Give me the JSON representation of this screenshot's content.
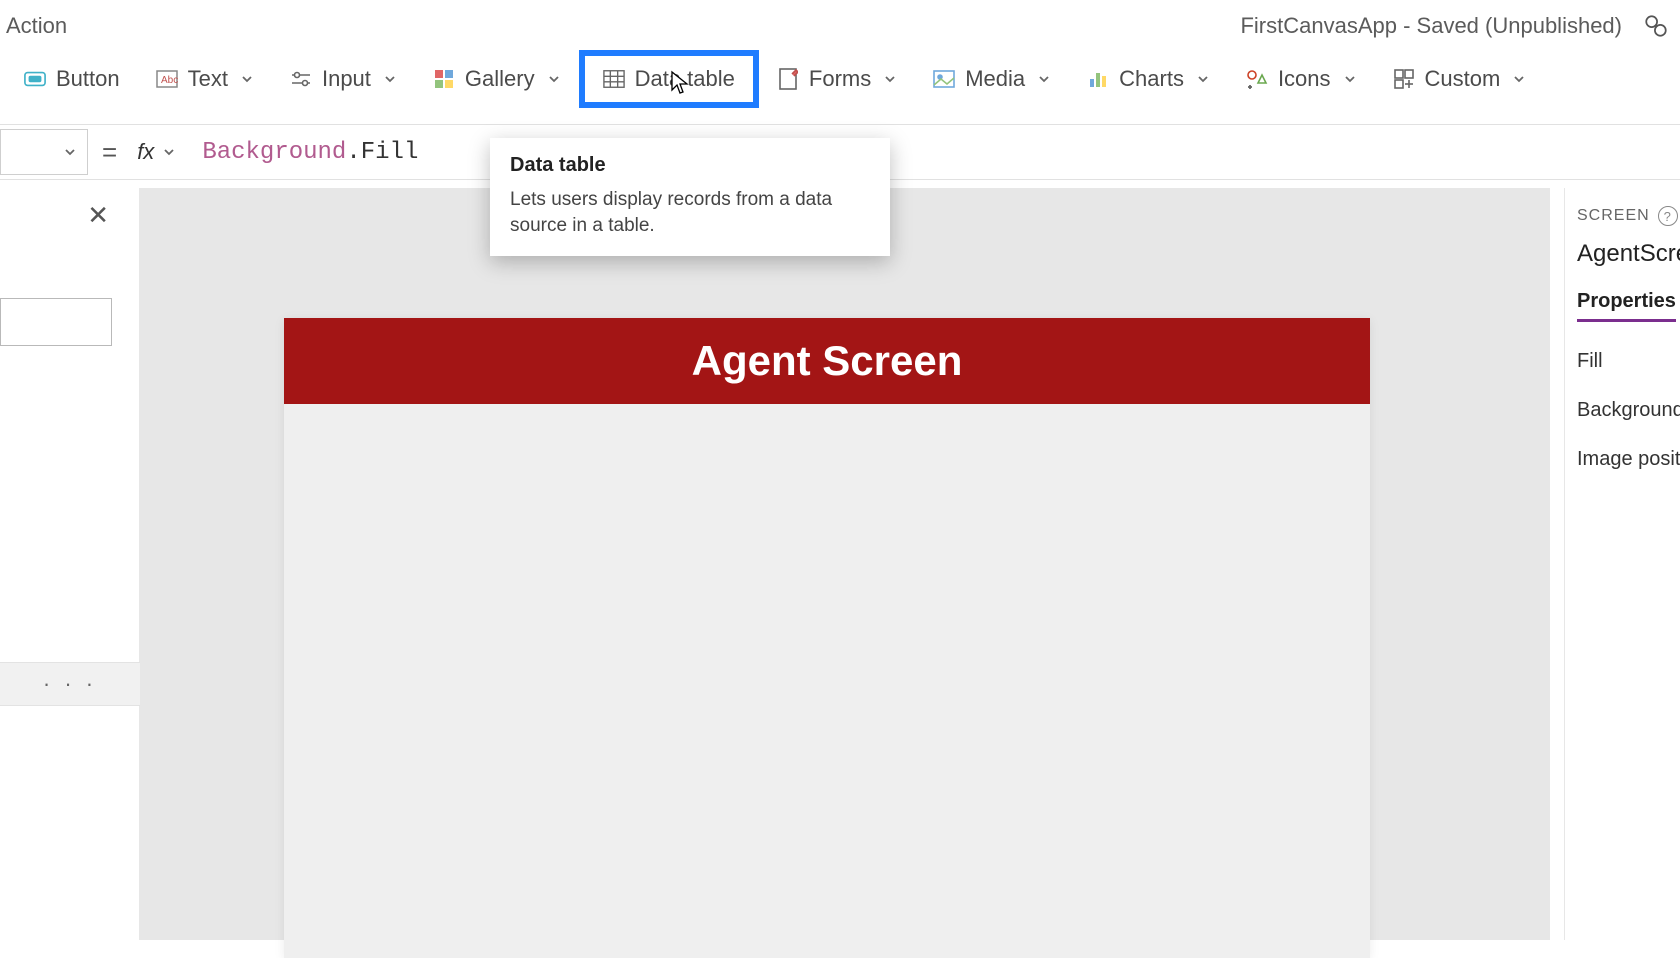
{
  "titlebar": {
    "left_tab": "Action",
    "save_state": "FirstCanvasApp - Saved (Unpublished)"
  },
  "ribbon": {
    "button": "Button",
    "text": "Text",
    "input": "Input",
    "gallery": "Gallery",
    "data_table": "Data table",
    "forms": "Forms",
    "media": "Media",
    "charts": "Charts",
    "icons": "Icons",
    "custom": "Custom"
  },
  "formula": {
    "eq": "=",
    "fx": "fx",
    "object": "Background",
    "property": ".Fill"
  },
  "tooltip": {
    "title": "Data table",
    "body": "Lets users display records from a data source in a table."
  },
  "canvas": {
    "header": "Agent Screen"
  },
  "props": {
    "section": "SCREEN",
    "help": "?",
    "name": "AgentScree",
    "tab": "Properties",
    "rows": {
      "fill": "Fill",
      "bgimage": "Background i",
      "imgpos": "Image positic"
    }
  },
  "misc": {
    "ellipsis": "· · ·",
    "close": "✕"
  }
}
